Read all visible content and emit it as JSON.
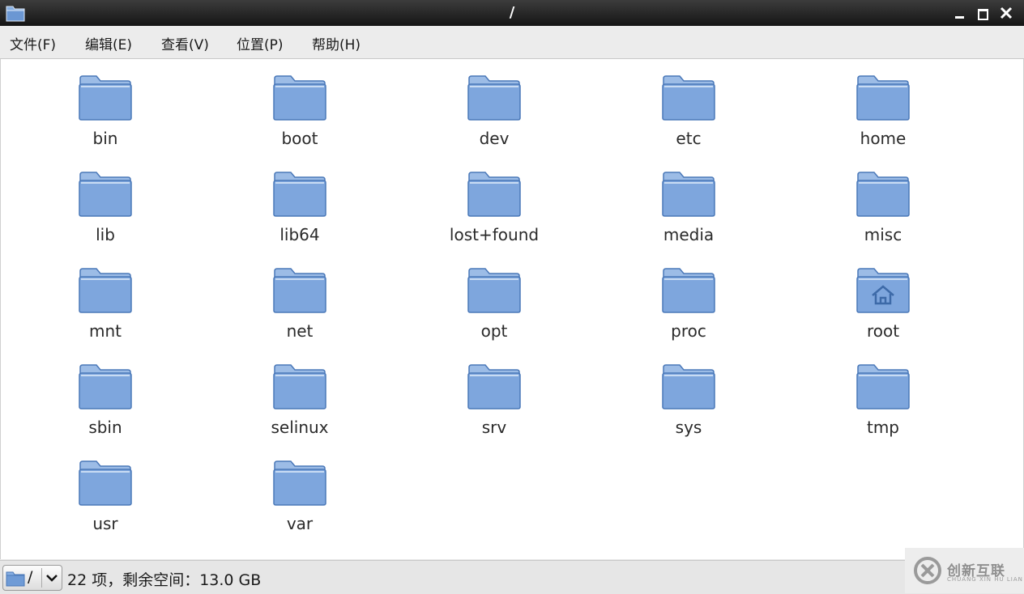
{
  "window": {
    "title": "/"
  },
  "menu": {
    "items": [
      {
        "label": "文件(F)"
      },
      {
        "label": "编辑(E)"
      },
      {
        "label": "查看(V)"
      },
      {
        "label": "位置(P)"
      },
      {
        "label": "帮助(H)"
      }
    ]
  },
  "folders": [
    {
      "label": "bin",
      "icon": "folder-icon"
    },
    {
      "label": "boot",
      "icon": "folder-icon"
    },
    {
      "label": "dev",
      "icon": "folder-icon"
    },
    {
      "label": "etc",
      "icon": "folder-icon"
    },
    {
      "label": "home",
      "icon": "folder-icon"
    },
    {
      "label": "lib",
      "icon": "folder-icon"
    },
    {
      "label": "lib64",
      "icon": "folder-icon"
    },
    {
      "label": "lost+found",
      "icon": "folder-icon"
    },
    {
      "label": "media",
      "icon": "folder-icon"
    },
    {
      "label": "misc",
      "icon": "folder-icon"
    },
    {
      "label": "mnt",
      "icon": "folder-icon"
    },
    {
      "label": "net",
      "icon": "folder-icon"
    },
    {
      "label": "opt",
      "icon": "folder-icon"
    },
    {
      "label": "proc",
      "icon": "folder-icon"
    },
    {
      "label": "root",
      "icon": "home-folder-icon"
    },
    {
      "label": "sbin",
      "icon": "folder-icon"
    },
    {
      "label": "selinux",
      "icon": "folder-icon"
    },
    {
      "label": "srv",
      "icon": "folder-icon"
    },
    {
      "label": "sys",
      "icon": "folder-icon"
    },
    {
      "label": "tmp",
      "icon": "folder-icon"
    },
    {
      "label": "usr",
      "icon": "folder-icon"
    },
    {
      "label": "var",
      "icon": "folder-icon"
    }
  ],
  "statusbar": {
    "path": "/",
    "info": "22 项，剩余空间：13.0 GB"
  },
  "watermark": {
    "text": "创新互联",
    "sub": "CHUANG XIN HU LIAN"
  },
  "colors": {
    "folder_fill": "#7ea6dd",
    "folder_stroke": "#4a78b8",
    "titlebar": "#1f1f1f"
  }
}
